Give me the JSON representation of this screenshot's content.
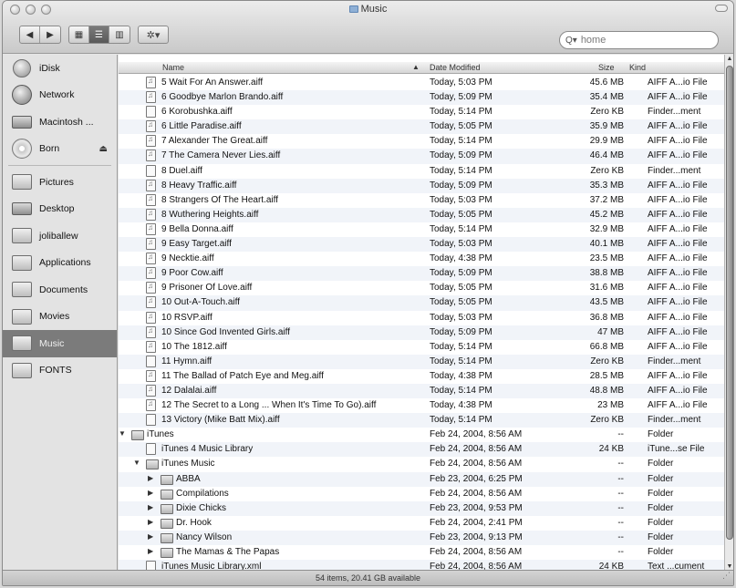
{
  "window": {
    "title": "Music"
  },
  "toolbar": {
    "back_icon": "back-arrow-icon",
    "forward_icon": "forward-arrow-icon",
    "action_label": "✲▾"
  },
  "search": {
    "placeholder": "home"
  },
  "sidebar": {
    "items": [
      {
        "label": "iDisk",
        "icon": "idisk-icon"
      },
      {
        "label": "Network",
        "icon": "network-icon"
      },
      {
        "label": "Macintosh ...",
        "icon": "hard-disk-icon"
      },
      {
        "label": "Born",
        "icon": "cd-icon",
        "eject": "⏏"
      },
      {
        "label": "Pictures",
        "icon": "pictures-folder-icon"
      },
      {
        "label": "Desktop",
        "icon": "desktop-icon"
      },
      {
        "label": "joliballew",
        "icon": "home-icon"
      },
      {
        "label": "Applications",
        "icon": "applications-icon"
      },
      {
        "label": "Documents",
        "icon": "documents-icon"
      },
      {
        "label": "Movies",
        "icon": "movies-icon"
      },
      {
        "label": "Music",
        "icon": "music-folder-icon",
        "selected": true
      },
      {
        "label": "FONTS",
        "icon": "folder-icon"
      }
    ]
  },
  "list": {
    "columns": {
      "name": "Name",
      "date": "Date Modified",
      "size": "Size",
      "kind": "Kind"
    },
    "sort_indicator": "▲",
    "rows": [
      {
        "depth": 1,
        "disc": "",
        "type": "audio",
        "name": "5 Wait For An Answer.aiff",
        "date": "Today, 5:03 PM",
        "size": "45.6 MB",
        "kind": "AIFF A...io File"
      },
      {
        "depth": 1,
        "disc": "",
        "type": "audio",
        "name": "6 Goodbye Marlon Brando.aiff",
        "date": "Today, 5:09 PM",
        "size": "35.4 MB",
        "kind": "AIFF A...io File"
      },
      {
        "depth": 1,
        "disc": "",
        "type": "doc",
        "name": "6 Korobushka.aiff",
        "date": "Today, 5:14 PM",
        "size": "Zero KB",
        "kind": "Finder...ment"
      },
      {
        "depth": 1,
        "disc": "",
        "type": "audio",
        "name": "6 Little Paradise.aiff",
        "date": "Today, 5:05 PM",
        "size": "35.9 MB",
        "kind": "AIFF A...io File"
      },
      {
        "depth": 1,
        "disc": "",
        "type": "audio",
        "name": "7 Alexander The Great.aiff",
        "date": "Today, 5:14 PM",
        "size": "29.9 MB",
        "kind": "AIFF A...io File"
      },
      {
        "depth": 1,
        "disc": "",
        "type": "audio",
        "name": "7 The Camera Never Lies.aiff",
        "date": "Today, 5:09 PM",
        "size": "46.4 MB",
        "kind": "AIFF A...io File"
      },
      {
        "depth": 1,
        "disc": "",
        "type": "doc",
        "name": "8 Duel.aiff",
        "date": "Today, 5:14 PM",
        "size": "Zero KB",
        "kind": "Finder...ment"
      },
      {
        "depth": 1,
        "disc": "",
        "type": "audio",
        "name": "8 Heavy Traffic.aiff",
        "date": "Today, 5:09 PM",
        "size": "35.3 MB",
        "kind": "AIFF A...io File"
      },
      {
        "depth": 1,
        "disc": "",
        "type": "audio",
        "name": "8 Strangers Of The Heart.aiff",
        "date": "Today, 5:03 PM",
        "size": "37.2 MB",
        "kind": "AIFF A...io File"
      },
      {
        "depth": 1,
        "disc": "",
        "type": "audio",
        "name": "8 Wuthering Heights.aiff",
        "date": "Today, 5:05 PM",
        "size": "45.2 MB",
        "kind": "AIFF A...io File"
      },
      {
        "depth": 1,
        "disc": "",
        "type": "audio",
        "name": "9 Bella Donna.aiff",
        "date": "Today, 5:14 PM",
        "size": "32.9 MB",
        "kind": "AIFF A...io File"
      },
      {
        "depth": 1,
        "disc": "",
        "type": "audio",
        "name": "9 Easy Target.aiff",
        "date": "Today, 5:03 PM",
        "size": "40.1 MB",
        "kind": "AIFF A...io File"
      },
      {
        "depth": 1,
        "disc": "",
        "type": "audio",
        "name": "9 Necktie.aiff",
        "date": "Today, 4:38 PM",
        "size": "23.5 MB",
        "kind": "AIFF A...io File"
      },
      {
        "depth": 1,
        "disc": "",
        "type": "audio",
        "name": "9 Poor Cow.aiff",
        "date": "Today, 5:09 PM",
        "size": "38.8 MB",
        "kind": "AIFF A...io File"
      },
      {
        "depth": 1,
        "disc": "",
        "type": "audio",
        "name": "9 Prisoner Of Love.aiff",
        "date": "Today, 5:05 PM",
        "size": "31.6 MB",
        "kind": "AIFF A...io File"
      },
      {
        "depth": 1,
        "disc": "",
        "type": "audio",
        "name": "10 Out-A-Touch.aiff",
        "date": "Today, 5:05 PM",
        "size": "43.5 MB",
        "kind": "AIFF A...io File"
      },
      {
        "depth": 1,
        "disc": "",
        "type": "audio",
        "name": "10 RSVP.aiff",
        "date": "Today, 5:03 PM",
        "size": "36.8 MB",
        "kind": "AIFF A...io File"
      },
      {
        "depth": 1,
        "disc": "",
        "type": "audio",
        "name": "10 Since God Invented Girls.aiff",
        "date": "Today, 5:09 PM",
        "size": "47 MB",
        "kind": "AIFF A...io File"
      },
      {
        "depth": 1,
        "disc": "",
        "type": "audio",
        "name": "10 The 1812.aiff",
        "date": "Today, 5:14 PM",
        "size": "66.8 MB",
        "kind": "AIFF A...io File"
      },
      {
        "depth": 1,
        "disc": "",
        "type": "doc",
        "name": "11 Hymn.aiff",
        "date": "Today, 5:14 PM",
        "size": "Zero KB",
        "kind": "Finder...ment"
      },
      {
        "depth": 1,
        "disc": "",
        "type": "audio",
        "name": "11 The Ballad of Patch Eye and Meg.aiff",
        "date": "Today, 4:38 PM",
        "size": "28.5 MB",
        "kind": "AIFF A...io File"
      },
      {
        "depth": 1,
        "disc": "",
        "type": "audio",
        "name": "12 Dalalai.aiff",
        "date": "Today, 5:14 PM",
        "size": "48.8 MB",
        "kind": "AIFF A...io File"
      },
      {
        "depth": 1,
        "disc": "",
        "type": "audio",
        "name": "12 The Secret to a Long ... When It's Time To Go).aiff",
        "date": "Today, 4:38 PM",
        "size": "23 MB",
        "kind": "AIFF A...io File"
      },
      {
        "depth": 1,
        "disc": "",
        "type": "doc",
        "name": "13 Victory (Mike Batt Mix).aiff",
        "date": "Today, 5:14 PM",
        "size": "Zero KB",
        "kind": "Finder...ment"
      },
      {
        "depth": 0,
        "disc": "▼",
        "type": "folder",
        "name": "iTunes",
        "date": "Feb 24, 2004, 8:56 AM",
        "size": "--",
        "kind": "Folder"
      },
      {
        "depth": 1,
        "disc": "",
        "type": "doc",
        "name": "iTunes 4 Music Library",
        "date": "Feb 24, 2004, 8:56 AM",
        "size": "24 KB",
        "kind": "iTune...se File"
      },
      {
        "depth": 1,
        "disc": "▼",
        "type": "folder",
        "name": "iTunes Music",
        "date": "Feb 24, 2004, 8:56 AM",
        "size": "--",
        "kind": "Folder"
      },
      {
        "depth": 2,
        "disc": "▶",
        "type": "folder",
        "name": "ABBA",
        "date": "Feb 23, 2004, 6:25 PM",
        "size": "--",
        "kind": "Folder"
      },
      {
        "depth": 2,
        "disc": "▶",
        "type": "folder",
        "name": "Compilations",
        "date": "Feb 24, 2004, 8:56 AM",
        "size": "--",
        "kind": "Folder"
      },
      {
        "depth": 2,
        "disc": "▶",
        "type": "folder",
        "name": "Dixie Chicks",
        "date": "Feb 23, 2004, 9:53 PM",
        "size": "--",
        "kind": "Folder"
      },
      {
        "depth": 2,
        "disc": "▶",
        "type": "folder",
        "name": "Dr. Hook",
        "date": "Feb 24, 2004, 2:41 PM",
        "size": "--",
        "kind": "Folder"
      },
      {
        "depth": 2,
        "disc": "▶",
        "type": "folder",
        "name": "Nancy Wilson",
        "date": "Feb 23, 2004, 9:13 PM",
        "size": "--",
        "kind": "Folder"
      },
      {
        "depth": 2,
        "disc": "▶",
        "type": "folder",
        "name": "The Mamas & The Papas",
        "date": "Feb 24, 2004, 8:56 AM",
        "size": "--",
        "kind": "Folder"
      },
      {
        "depth": 1,
        "disc": "",
        "type": "doc",
        "name": "iTunes Music Library.xml",
        "date": "Feb 24, 2004, 8:56 AM",
        "size": "24 KB",
        "kind": "Text ...cument"
      }
    ]
  },
  "status": {
    "text": "54 items, 20.41 GB available"
  }
}
